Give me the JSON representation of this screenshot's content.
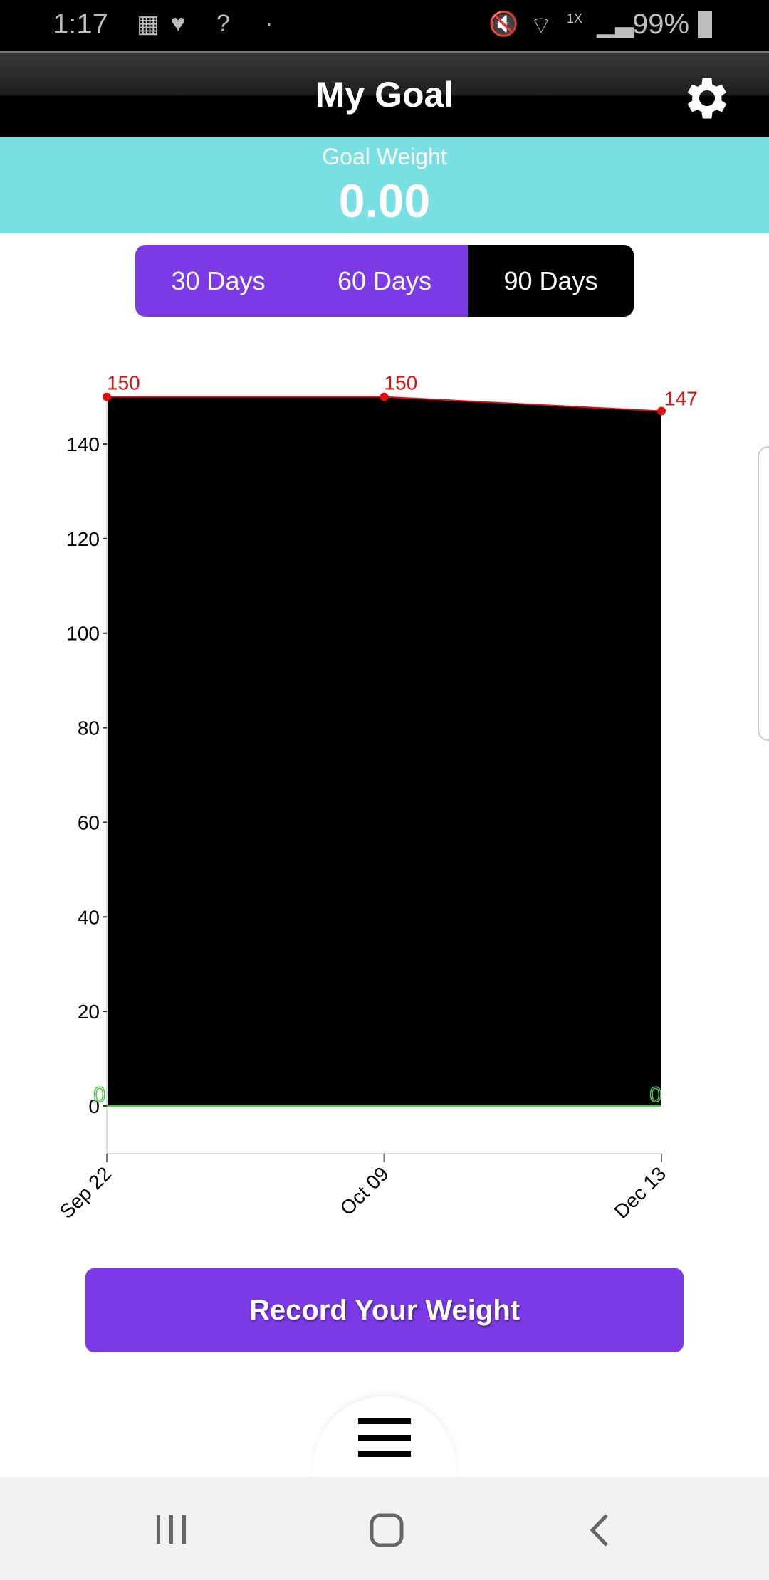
{
  "status_bar": {
    "time": "1:17",
    "battery": "99%",
    "network": "1X"
  },
  "header": {
    "title": "My Goal",
    "settings_icon": "gear-icon"
  },
  "goal": {
    "label": "Goal Weight",
    "value": "0.00"
  },
  "range_tabs": [
    {
      "label": "30 Days",
      "selected": false
    },
    {
      "label": "60 Days",
      "selected": false
    },
    {
      "label": "90 Days",
      "selected": true
    }
  ],
  "colors": {
    "accent": "#7b3ae5",
    "goal_band": "#78e0e2",
    "weight_line": "#e01010",
    "goal_line": "#4ccc4c"
  },
  "chart_data": {
    "type": "line",
    "categories": [
      "Sep 22",
      "Oct 09",
      "Dec 13"
    ],
    "series": [
      {
        "values": [
          150,
          150,
          147
        ],
        "color": "#e01010",
        "labels": [
          "150",
          "150",
          "147"
        ],
        "fill": "#000000"
      },
      {
        "values": [
          0,
          0,
          0
        ],
        "color": "#4ccc4c",
        "labels": [
          "0",
          "",
          "0"
        ]
      }
    ],
    "y_ticks": [
      0,
      20,
      40,
      60,
      80,
      100,
      120,
      140
    ],
    "ylim": [
      -10,
      150
    ],
    "grid": false
  },
  "record_button": {
    "label": "Record Your Weight"
  },
  "menu_icon": "hamburger-icon"
}
